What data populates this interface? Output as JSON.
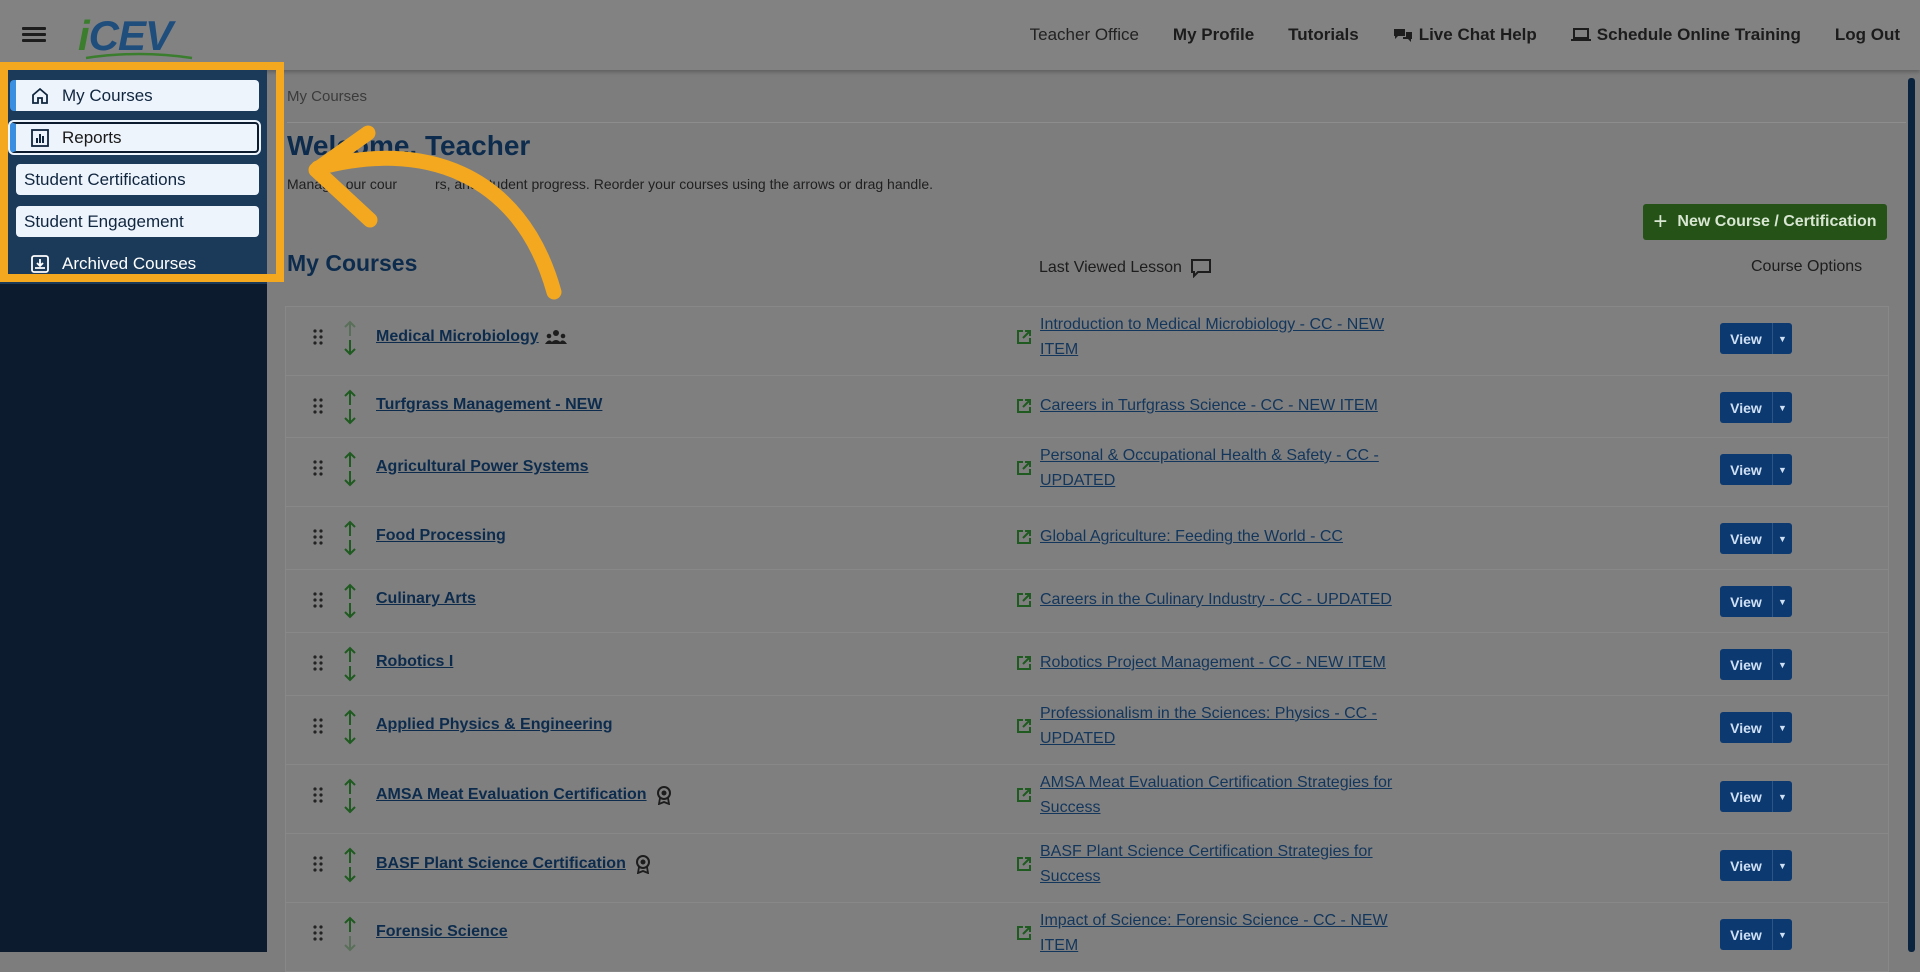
{
  "header": {
    "nav": {
      "teacher_office": "Teacher Office",
      "my_profile": "My Profile",
      "tutorials": "Tutorials",
      "live_chat": "Live Chat Help",
      "schedule_training": "Schedule Online Training",
      "log_out": "Log Out"
    }
  },
  "logo": {
    "text_i": "i",
    "text_cev": "CEV"
  },
  "sidebar": {
    "items": [
      {
        "label": "My Courses",
        "icon": "home-icon"
      },
      {
        "label": "Reports",
        "icon": "chart-icon"
      },
      {
        "label": "Student Certifications"
      },
      {
        "label": "Student Engagement"
      },
      {
        "label": "Archived Courses",
        "icon": "archive-icon"
      }
    ]
  },
  "main": {
    "breadcrumb": "My Courses",
    "welcome": "Welcome, Teacher",
    "subtitle_left": "Manag",
    "subtitle_mid": "our cour",
    "subtitle_right": "rs, and student progress. Reorder your courses using the arrows or drag handle.",
    "new_button": "New Course / Certification",
    "section_title": "My Courses",
    "col_last_viewed": "Last Viewed Lesson",
    "col_options": "Course Options",
    "view_label": "View"
  },
  "courses": [
    {
      "name": "Medical Microbiology",
      "badge": "group-icon",
      "lesson": "Introduction to Medical Microbiology - CC - NEW ITEM",
      "lines": 2
    },
    {
      "name": "Turfgrass Management - NEW",
      "badge": null,
      "lesson": "Careers in Turfgrass Science - CC - NEW ITEM",
      "lines": 1
    },
    {
      "name": "Agricultural Power Systems",
      "badge": null,
      "lesson": "Personal & Occupational Health & Safety - CC - UPDATED",
      "lines": 2
    },
    {
      "name": "Food Processing",
      "badge": null,
      "lesson": "Global Agriculture: Feeding the World - CC",
      "lines": 1
    },
    {
      "name": "Culinary Arts",
      "badge": null,
      "lesson": "Careers in the Culinary Industry - CC - UPDATED",
      "lines": 1
    },
    {
      "name": "Robotics I",
      "badge": null,
      "lesson": "Robotics Project Management - CC - NEW ITEM",
      "lines": 1
    },
    {
      "name": "Applied Physics & Engineering",
      "badge": null,
      "lesson": "Professionalism in the Sciences: Physics - CC - UPDATED",
      "lines": 2
    },
    {
      "name": "AMSA Meat Evaluation Certification",
      "badge": "certification-icon",
      "lesson": "AMSA Meat Evaluation Certification Strategies for Success",
      "lines": 2
    },
    {
      "name": "BASF Plant Science Certification",
      "badge": "certification-icon",
      "lesson": "BASF Plant Science Certification Strategies for Success",
      "lines": 2
    },
    {
      "name": "Forensic Science",
      "badge": null,
      "lesson": "Impact of Science: Forensic Science - CC - NEW ITEM",
      "lines": 2
    }
  ],
  "colors": {
    "highlight": "#f3a81f",
    "primary": "#0c3970",
    "success": "#245217",
    "sidebar_bg": "#0c1c2e"
  }
}
